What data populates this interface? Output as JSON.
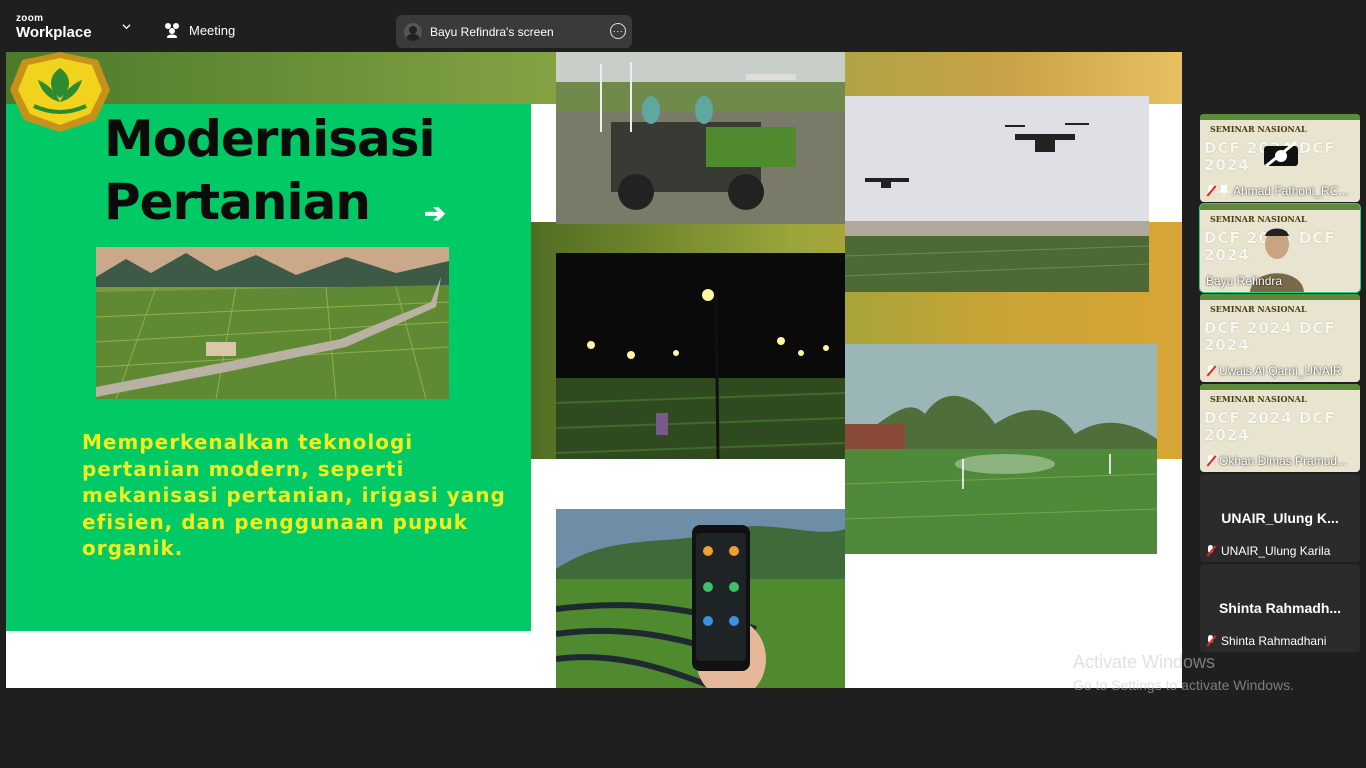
{
  "app": {
    "brand_small": "zoom",
    "brand_large": "Workplace",
    "meeting_label": "Meeting"
  },
  "share": {
    "label": "Bayu Refindra's screen",
    "more": "···"
  },
  "slide": {
    "title_line1": "Modernisasi",
    "title_line2": "Pertanian",
    "arrow": "➔",
    "description": "Memperkenalkan teknologi pertanian modern, seperti mekanisasi pertanian, irigasi yang efisien, dan penggunaan pupuk organik."
  },
  "watermark": {
    "line1": "Activate Windows",
    "line2": "Go to Settings to activate Windows."
  },
  "thumb_text": {
    "seminar": "SEMINAR NASIONAL",
    "dcf": "DCF 2024 DCF 2024"
  },
  "participants": [
    {
      "name": "Ahmad Fathoni_RC...",
      "muted": true
    },
    {
      "name": "Bayu Refindra",
      "muted": false,
      "active": true
    },
    {
      "name": "Uwais Al Qarni_UNAIR",
      "muted": true
    },
    {
      "name": "Okhan Dimas Pramud...",
      "muted": true
    },
    {
      "name_big": "UNAIR_Ulung  K...",
      "name": "UNAIR_Ulung Karila",
      "muted": true
    },
    {
      "name_big": "Shinta  Rahmadh...",
      "name": "Shinta Rahmadhani",
      "muted": true
    }
  ],
  "colors": {
    "topbar": "#1f1f1f",
    "slide_green": "#00c965",
    "slide_text_yellow": "#f0f020",
    "active_border": "#23d18b"
  }
}
